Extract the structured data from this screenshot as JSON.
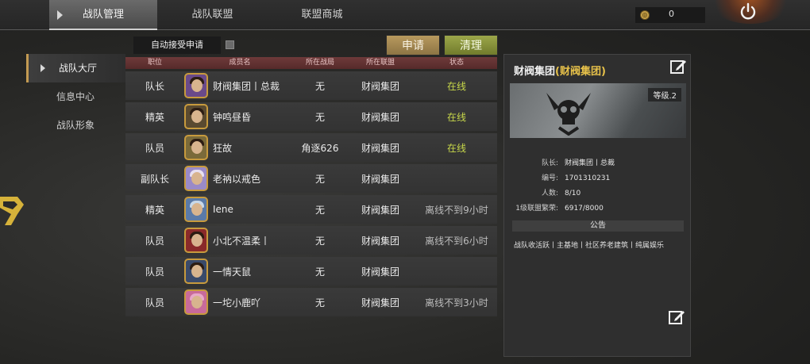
{
  "tabs": [
    {
      "label": "战队管理",
      "active": true
    },
    {
      "label": "战队联盟",
      "active": false
    },
    {
      "label": "联盟商城",
      "active": false
    }
  ],
  "currency": {
    "value": "0",
    "icon": "coin-icon"
  },
  "toolbar": {
    "auto_accept_label": "自动接受申请",
    "auto_accept_checked": false,
    "apply_label": "申请",
    "clean_label": "清理"
  },
  "sidebar": {
    "items": [
      {
        "label": "战队大厅",
        "active": true
      },
      {
        "label": "信息中心",
        "active": false
      },
      {
        "label": "战队形象",
        "active": false
      }
    ]
  },
  "table": {
    "headers": {
      "role": "职位",
      "name": "成员名",
      "zone": "所在战局",
      "union": "所在联盟",
      "status": "状态"
    },
    "rows": [
      {
        "role": "队长",
        "name": "财阀集团丨总裁",
        "zone": "无",
        "union": "财阀集团",
        "status": "在线",
        "online": true
      },
      {
        "role": "精英",
        "name": "钟鸣昼昏",
        "zone": "无",
        "union": "财阀集团",
        "status": "在线",
        "online": true
      },
      {
        "role": "队员",
        "name": "狂故",
        "zone": "角逐626",
        "union": "财阀集团",
        "status": "在线",
        "online": true
      },
      {
        "role": "副队长",
        "name": "老衲以戒色",
        "zone": "无",
        "union": "财阀集团",
        "status": "",
        "online": false
      },
      {
        "role": "精英",
        "name": "Iene",
        "zone": "无",
        "union": "财阀集团",
        "status": "离线不到9小时",
        "online": false
      },
      {
        "role": "队员",
        "name": "小北不温柔丨",
        "zone": "无",
        "union": "财阀集团",
        "status": "离线不到6小时",
        "online": false
      },
      {
        "role": "队员",
        "name": "一情天鼠",
        "zone": "无",
        "union": "财阀集团",
        "status": "",
        "online": false
      },
      {
        "role": "队员",
        "name": "一坨小鹿吖",
        "zone": "无",
        "union": "财阀集团",
        "status": "离线不到3小时",
        "online": false
      }
    ]
  },
  "team_panel": {
    "name": "财阀集团",
    "union_name": "财阀集团",
    "level": "等级.2",
    "info": [
      {
        "key": "队长:",
        "value": "财阀集团丨总裁"
      },
      {
        "key": "编号:",
        "value": "1701310231"
      },
      {
        "key": "人数:",
        "value": "8/10"
      },
      {
        "key": "1级联盟繁荣:",
        "value": "6917/8000"
      }
    ],
    "notice_title": "公告",
    "notice_text": "战队收活跃丨主基地丨社区养老建筑丨纯属娱乐"
  },
  "colors": {
    "online": "#c8d84a",
    "accent_gold": "#e8c24a",
    "apply_button": "#b89a5e",
    "clean_button": "#9ca74a",
    "header_red": "#6e3a3a"
  }
}
